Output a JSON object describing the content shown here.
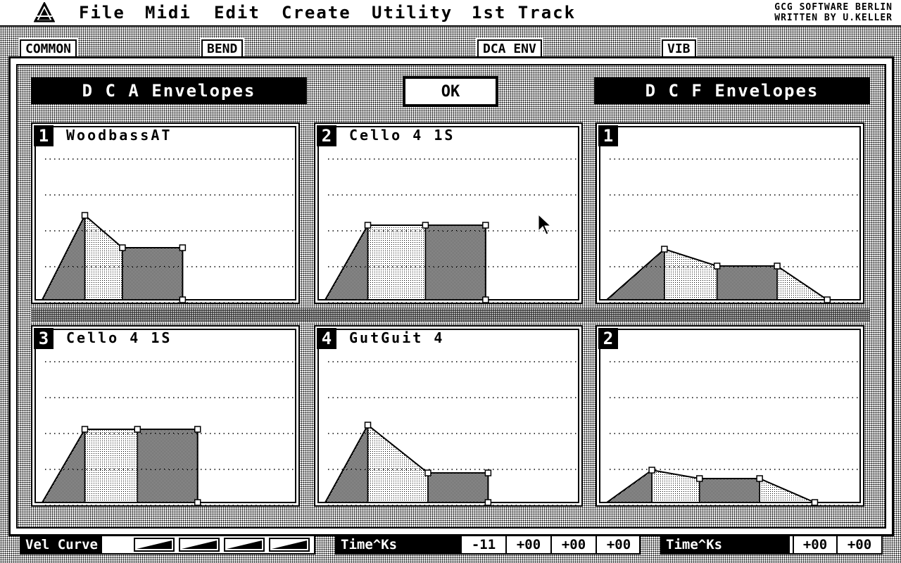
{
  "menubar": {
    "items": [
      "File",
      "Midi",
      "Edit",
      "Create",
      "Utility",
      "1st Track"
    ],
    "credit_line1": "GCG SOFTWARE BERLIN",
    "credit_line2": "WRITTEN BY U.KELLER"
  },
  "tabs": [
    "COMMON",
    "BEND",
    "DCA ENV",
    "VIB"
  ],
  "dialog": {
    "dca_header": "D C A  Envelopes",
    "dcf_header": "D C F  Envelopes",
    "ok_label": "OK",
    "dca_panels": [
      {
        "number": "1",
        "name": "WoodbassAT",
        "points": [
          [
            0,
            0
          ],
          [
            0.17,
            0.6
          ],
          [
            0.32,
            0.37
          ],
          [
            0.56,
            0.37
          ],
          [
            0.56,
            0
          ]
        ]
      },
      {
        "number": "2",
        "name": "Cello 4 1S",
        "points": [
          [
            0,
            0
          ],
          [
            0.17,
            0.53
          ],
          [
            0.4,
            0.53
          ],
          [
            0.64,
            0.53
          ],
          [
            0.64,
            0
          ]
        ]
      },
      {
        "number": "3",
        "name": "Cello 4 1S",
        "points": [
          [
            0,
            0
          ],
          [
            0.17,
            0.52
          ],
          [
            0.38,
            0.52
          ],
          [
            0.62,
            0.52
          ],
          [
            0.62,
            0
          ]
        ]
      },
      {
        "number": "4",
        "name": "GutGuit 4",
        "points": [
          [
            0,
            0
          ],
          [
            0.17,
            0.55
          ],
          [
            0.41,
            0.21
          ],
          [
            0.65,
            0.21
          ],
          [
            0.65,
            0
          ]
        ]
      }
    ],
    "dcf_panels": [
      {
        "number": "1",
        "points": [
          [
            0,
            0
          ],
          [
            0.23,
            0.36
          ],
          [
            0.44,
            0.24
          ],
          [
            0.68,
            0.24
          ],
          [
            0.88,
            0
          ]
        ]
      },
      {
        "number": "2",
        "points": [
          [
            0,
            0
          ],
          [
            0.18,
            0.23
          ],
          [
            0.37,
            0.17
          ],
          [
            0.61,
            0.17
          ],
          [
            0.83,
            0
          ]
        ]
      }
    ]
  },
  "bottom": {
    "vel_curve_label": "Vel Curve",
    "dca_timeks_label": "Time^Ks",
    "dca_timeks_values": [
      "-11",
      "+00",
      "+00",
      "+00"
    ],
    "dcf_timeks_label": "Time^Ks",
    "dcf_timeks_values": [
      "+00",
      "+00"
    ]
  }
}
